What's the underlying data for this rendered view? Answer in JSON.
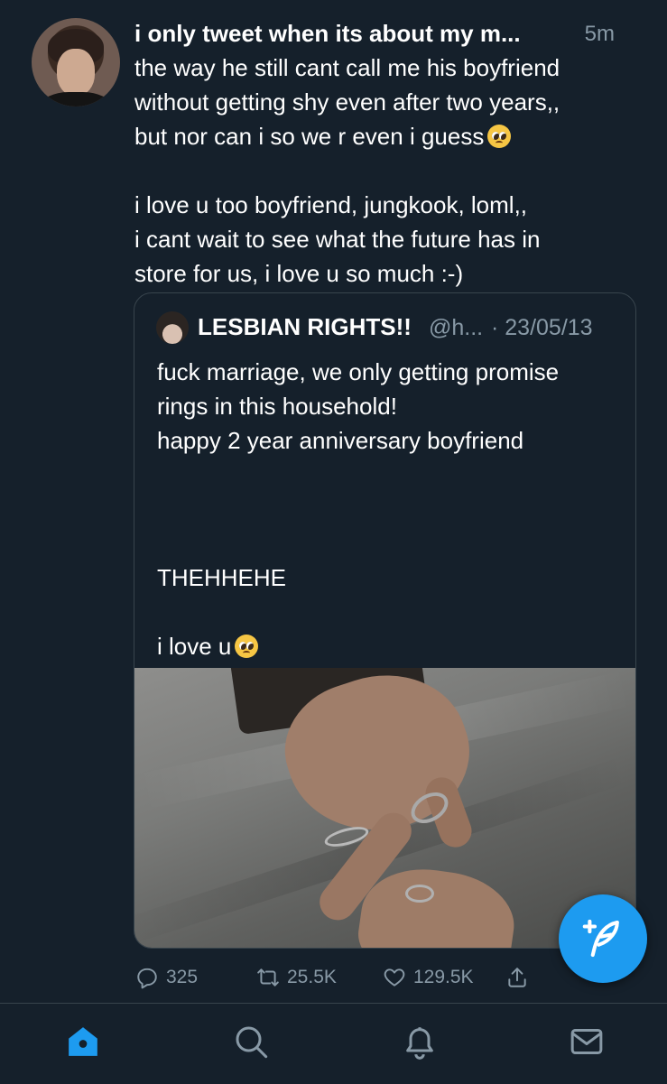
{
  "tweet": {
    "display_name": "i only tweet when its about my m...",
    "time": "5m",
    "text_para1": "the way he still cant call me his boyfriend\nwithout getting shy even after two years,,\nbut nor can i so we r even i guess",
    "text_para2": "i love u too boyfriend, jungkook, loml,,\ni cant wait to see what the future has in\nstore for us, i love u so much :-)",
    "emoji_icon": "pleading-face-emoji"
  },
  "quoted_tweet": {
    "display_name": "LESBIAN RIGHTS!!",
    "handle": "@h...",
    "date": "· 23/05/13",
    "text_part1": "fuck marriage, we only getting promise\nrings in this household!\nhappy 2 year anniversary boyfriend\n\n\n\nTHEHHEHE\n\ni love u",
    "emoji_icon": "pleading-face-emoji",
    "image_description_icon": "hands-with-rings-photo"
  },
  "actions": {
    "reply_count": "325",
    "retweet_count": "25.5K",
    "like_count": "129.5K"
  },
  "fab": {
    "icon": "compose-tweet-icon",
    "color": "#1d9bf0"
  },
  "nav": {
    "home_icon": "home-icon",
    "search_icon": "search-icon",
    "notifications_icon": "bell-icon",
    "messages_icon": "mail-icon",
    "active_color": "#1d9bf0"
  },
  "theme": {
    "background": "#15202b",
    "muted_text": "#8899a6",
    "border": "#38444d"
  }
}
